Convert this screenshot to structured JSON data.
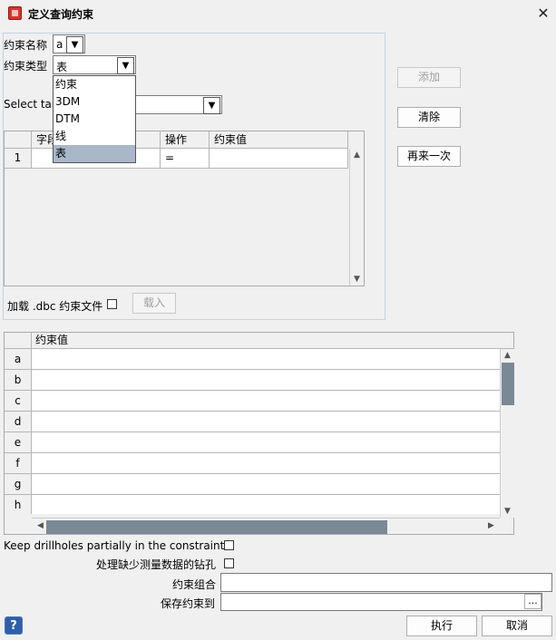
{
  "window": {
    "title": "定义查询约束",
    "close_glyph": "✕"
  },
  "form": {
    "name_label": "约束名称",
    "name_value": "a",
    "type_label": "约束类型",
    "type_value": "表",
    "type_options": [
      "约束",
      "3DM",
      "DTM",
      "线",
      "表"
    ],
    "type_selected_index": 4,
    "select_table_label": "Select tab"
  },
  "constraint_grid": {
    "headers": [
      "字段",
      "操作",
      "约束值"
    ],
    "rows": [
      {
        "num": "1",
        "field": "",
        "op": "=",
        "value": ""
      }
    ]
  },
  "load_dbc": {
    "label": "加载 .dbc 约束文件",
    "checked": false,
    "button": "载入"
  },
  "side_buttons": {
    "add": "添加",
    "clear": "清除",
    "again": "再来一次"
  },
  "values_grid": {
    "header": "约束值",
    "rows": [
      "a",
      "b",
      "c",
      "d",
      "e",
      "f",
      "g",
      "h"
    ]
  },
  "options": {
    "keep_partial_label": "Keep drillholes partially in the constraint",
    "keep_partial_checked": false,
    "missing_label": "处理缺少测量数据的钻孔",
    "missing_checked": false,
    "combination_label": "约束组合",
    "combination_value": "",
    "save_label": "保存约束到",
    "save_value": "",
    "browse": "..."
  },
  "footer": {
    "help": "?",
    "execute": "执行",
    "cancel": "取消"
  }
}
